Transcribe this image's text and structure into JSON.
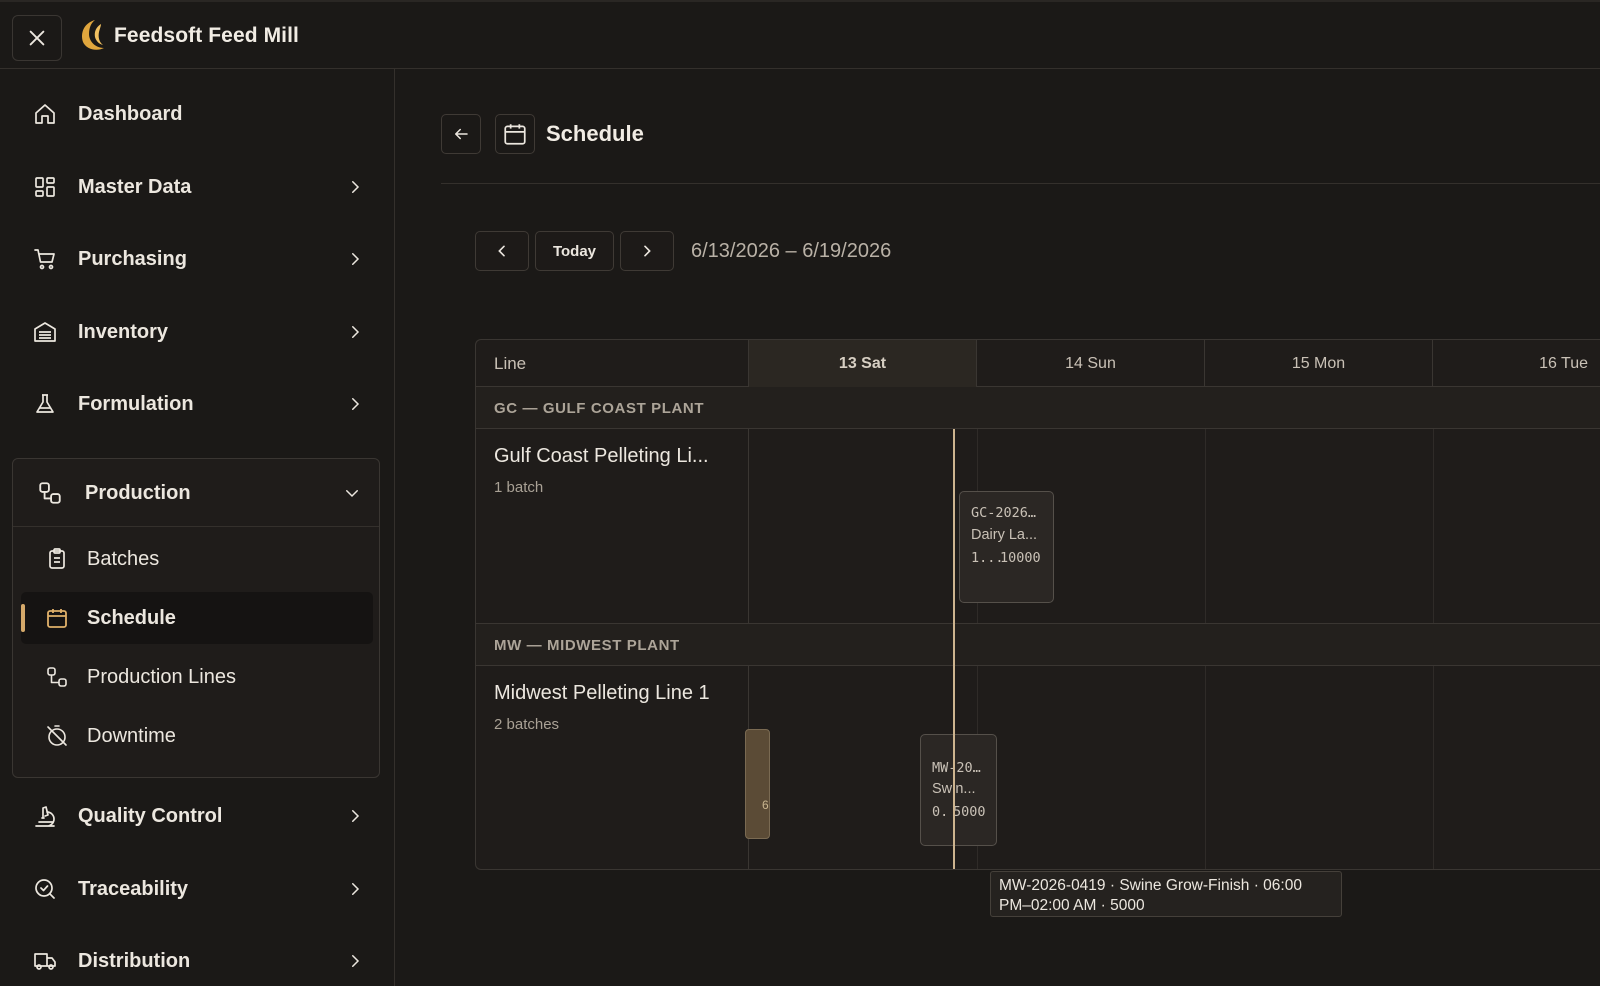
{
  "app": {
    "title": "Feedsoft Feed Mill",
    "logo_icon": "crescent-moon-logo"
  },
  "colors": {
    "accent": "#d5a96a",
    "background": "#1b1917",
    "panel": "#1f1c1a"
  },
  "sidebar": {
    "items": [
      {
        "label": "Dashboard",
        "icon": "home-icon"
      },
      {
        "label": "Master Data",
        "icon": "grid-icon"
      },
      {
        "label": "Purchasing",
        "icon": "cart-icon"
      },
      {
        "label": "Inventory",
        "icon": "warehouse-icon"
      },
      {
        "label": "Formulation",
        "icon": "flask-icon"
      }
    ],
    "production": {
      "label": "Production",
      "icon": "workflow-icon",
      "children": [
        {
          "label": "Batches",
          "icon": "clipboard-icon"
        },
        {
          "label": "Schedule",
          "icon": "calendar-icon",
          "active": true
        },
        {
          "label": "Production Lines",
          "icon": "workflow-icon"
        },
        {
          "label": "Downtime",
          "icon": "timer-off-icon"
        }
      ]
    },
    "bottom_items": [
      {
        "label": "Quality Control",
        "icon": "microscope-icon"
      },
      {
        "label": "Traceability",
        "icon": "search-check-icon"
      },
      {
        "label": "Distribution",
        "icon": "truck-icon"
      }
    ]
  },
  "page": {
    "title": "Schedule"
  },
  "toolbar": {
    "today_label": "Today",
    "date_range": "6/13/2026 – 6/19/2026"
  },
  "schedule": {
    "line_header": "Line",
    "days": [
      "13 Sat",
      "14 Sun",
      "15 Mon",
      "16 Tue"
    ],
    "today_index": 0,
    "plants": [
      {
        "label": "GC — GULF COAST PLANT",
        "lines": [
          {
            "name": "Gulf Coast Pelleting Li...",
            "count": "1 batch",
            "batches": [
              {
                "code": "GC-2026…",
                "product": "Dairy La...",
                "start": "1...",
                "qty": "10000"
              }
            ]
          }
        ]
      },
      {
        "label": "MW — MIDWEST PLANT",
        "lines": [
          {
            "name": "Midwest Pelleting Line 1",
            "count": "2 batches",
            "batches": [
              {
                "code": "",
                "product": "",
                "start": "6",
                "qty": ""
              },
              {
                "code": "MW-20…",
                "product": "Swin...",
                "start": "0.",
                "qty": "5000"
              }
            ]
          }
        ]
      }
    ]
  },
  "tooltip": {
    "line1": "MW-2026-0419 · Swine Grow-Finish · 06:00",
    "line2": "PM–02:00 AM · 5000"
  }
}
